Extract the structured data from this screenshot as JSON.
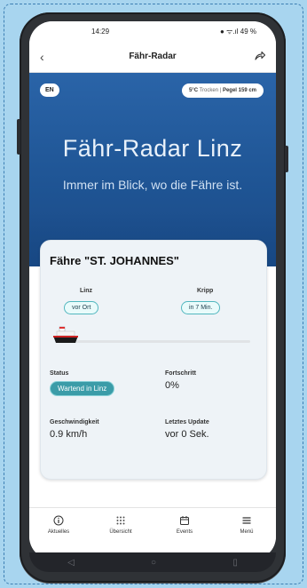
{
  "statusbar": {
    "time": "14:29",
    "indicators": "● ᯤ.ıl 49 %"
  },
  "appbar": {
    "title": "Fähr-Radar",
    "back_icon": "chevron-left-icon",
    "share_icon": "share-icon"
  },
  "hero": {
    "language": "EN",
    "weather_temp": "5°C",
    "weather_state": "Trocken",
    "weather_separator": "|",
    "water_level": "Pegel 159 cm",
    "title": "Fähr-Radar Linz",
    "subtitle": "Immer im Blick, wo die Fähre ist."
  },
  "ferry_card": {
    "title": "Fähre \"ST. JOHANNES\"",
    "from_port": "Linz",
    "from_chip": "vor Ort",
    "to_port": "Kripp",
    "to_chip": "in 7 Min.",
    "progress": 0,
    "status_label": "Status",
    "status_value": "Wartend in Linz",
    "progress_label": "Fortschritt",
    "progress_value": "0%",
    "speed_label": "Geschwindigkeit",
    "speed_value": "0.9 km/h",
    "update_label": "Letztes Update",
    "update_value": "vor 0 Sek."
  },
  "bottom_nav": [
    {
      "label": "Aktuelles",
      "icon": "info-icon"
    },
    {
      "label": "Übersicht",
      "icon": "grid-icon"
    },
    {
      "label": "Events",
      "icon": "calendar-icon"
    },
    {
      "label": "Menü",
      "icon": "menu-icon"
    }
  ],
  "colors": {
    "accent": "#3b9ca8",
    "hero_blue": "#1f5595",
    "background": "#a8d5ef"
  }
}
